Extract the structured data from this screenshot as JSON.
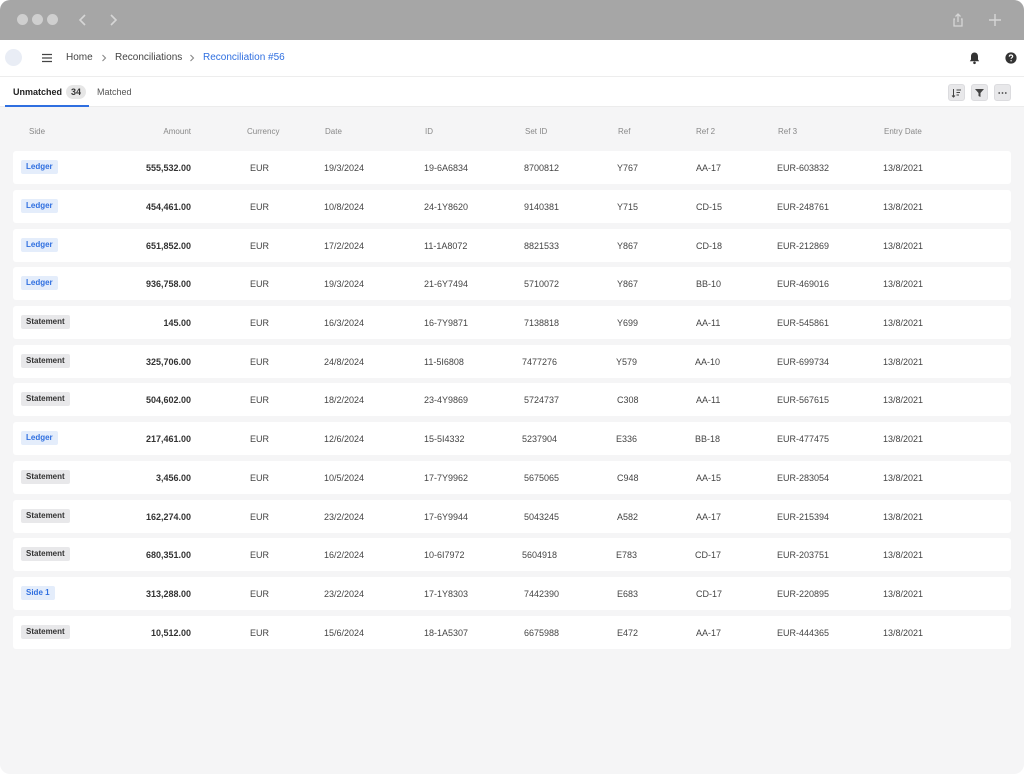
{
  "header": {
    "breadcrumbs": [
      "Home",
      "Reconciliations",
      "Reconciliation #56"
    ]
  },
  "tabs": [
    {
      "label": "Unmatched",
      "count": "34"
    },
    {
      "label": "Matched"
    }
  ],
  "toolbar": {
    "icons": [
      "sort-icon",
      "filter-icon",
      "more-icon"
    ]
  },
  "table": {
    "columns": [
      "Side",
      "Amount",
      "Currency",
      "Date",
      "ID",
      "Set ID",
      "Ref",
      "Ref 2",
      "Ref 3",
      "Entry Date"
    ],
    "rows": [
      {
        "side": "Ledger",
        "side_style": "blue",
        "amount": "555,532.00",
        "currency": "EUR",
        "date": "19/3/2024",
        "id": "19-6A6834",
        "set_id": "8700812",
        "ref": "Y767",
        "ref2": "AA-17",
        "ref3": "EUR-603832",
        "entry_date": "13/8/2021"
      },
      {
        "side": "Ledger",
        "side_style": "blue",
        "amount": "454,461.00",
        "currency": "EUR",
        "date": "10/8/2024",
        "id": "24-1Y8620",
        "set_id": "9140381",
        "ref": "Y715",
        "ref2": "CD-15",
        "ref3": "EUR-248761",
        "entry_date": "13/8/2021"
      },
      {
        "side": "Ledger",
        "side_style": "blue",
        "amount": "651,852.00",
        "currency": "EUR",
        "date": "17/2/2024",
        "id": "11-1A8072",
        "set_id": "8821533",
        "ref": "Y867",
        "ref2": "CD-18",
        "ref3": "EUR-212869",
        "entry_date": "13/8/2021"
      },
      {
        "side": "Ledger",
        "side_style": "blue",
        "amount": "936,758.00",
        "currency": "EUR",
        "date": "19/3/2024",
        "id": "21-6Y7494",
        "set_id": "5710072",
        "ref": "Y867",
        "ref2": "BB-10",
        "ref3": "EUR-469016",
        "entry_date": "13/8/2021"
      },
      {
        "side": "Statement",
        "side_style": "gray",
        "amount": "145.00",
        "currency": "EUR",
        "date": "16/3/2024",
        "id": "16-7Y9871",
        "set_id": "7138818",
        "ref": "Y699",
        "ref2": "AA-11",
        "ref3": "EUR-545861",
        "entry_date": "13/8/2021"
      },
      {
        "side": "Statement",
        "side_style": "gray",
        "amount": "325,706.00",
        "currency": "EUR",
        "date": "24/8/2024",
        "id": "11-5I6808",
        "set_id": "7477276",
        "ref": "Y579",
        "ref2": "AA-10",
        "ref3": "EUR-699734",
        "entry_date": "13/8/2021"
      },
      {
        "side": "Statement",
        "side_style": "gray",
        "amount": "504,602.00",
        "currency": "EUR",
        "date": "18/2/2024",
        "id": "23-4Y9869",
        "set_id": "5724737",
        "ref": "C308",
        "ref2": "AA-11",
        "ref3": "EUR-567615",
        "entry_date": "13/8/2021"
      },
      {
        "side": "Ledger",
        "side_style": "blue",
        "amount": "217,461.00",
        "currency": "EUR",
        "date": "12/6/2024",
        "id": "15-5I4332",
        "set_id": "5237904",
        "ref": "E336",
        "ref2": "BB-18",
        "ref3": "EUR-477475",
        "entry_date": "13/8/2021"
      },
      {
        "side": "Statement",
        "side_style": "gray",
        "amount": "3,456.00",
        "currency": "EUR",
        "date": "10/5/2024",
        "id": "17-7Y9962",
        "set_id": "5675065",
        "ref": "C948",
        "ref2": "AA-15",
        "ref3": "EUR-283054",
        "entry_date": "13/8/2021"
      },
      {
        "side": "Statement",
        "side_style": "gray",
        "amount": "162,274.00",
        "currency": "EUR",
        "date": "23/2/2024",
        "id": "17-6Y9944",
        "set_id": "5043245",
        "ref": "A582",
        "ref2": "AA-17",
        "ref3": "EUR-215394",
        "entry_date": "13/8/2021"
      },
      {
        "side": "Statement",
        "side_style": "gray",
        "amount": "680,351.00",
        "currency": "EUR",
        "date": "16/2/2024",
        "id": "10-6I7972",
        "set_id": "5604918",
        "ref": "E783",
        "ref2": "CD-17",
        "ref3": "EUR-203751",
        "entry_date": "13/8/2021"
      },
      {
        "side": "Side 1",
        "side_style": "blue",
        "amount": "313,288.00",
        "currency": "EUR",
        "date": "23/2/2024",
        "id": "17-1Y8303",
        "set_id": "7442390",
        "ref": "E683",
        "ref2": "CD-17",
        "ref3": "EUR-220895",
        "entry_date": "13/8/2021"
      },
      {
        "side": "Statement",
        "side_style": "gray",
        "amount": "10,512.00",
        "currency": "EUR",
        "date": "15/6/2024",
        "id": "18-1A5307",
        "set_id": "6675988",
        "ref": "E472",
        "ref2": "AA-17",
        "ref3": "EUR-444365",
        "entry_date": "13/8/2021"
      }
    ]
  }
}
